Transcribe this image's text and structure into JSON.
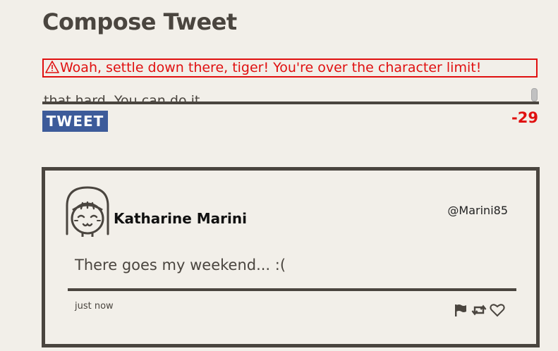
{
  "header": {
    "title": "Compose Tweet"
  },
  "compose": {
    "error_message": "Woah, settle down there, tiger! You're over the character limit!",
    "text_visible": "that hard. You can do it.",
    "char_count": "-29",
    "tweet_button_label": "TWEET"
  },
  "tweet": {
    "author_name": "Katharine Marini",
    "author_handle": "@Marini85",
    "body": "There goes my weekend... :(",
    "timestamp": "just now"
  },
  "icons": {
    "warning": "warning-icon",
    "avatar": "avatar-icon",
    "flag": "flag-icon",
    "retweet": "retweet-icon",
    "like": "heart-icon"
  },
  "colors": {
    "background": "#f2efe9",
    "text": "#4a453f",
    "error": "#e01010",
    "button": "#3d5b9a"
  }
}
